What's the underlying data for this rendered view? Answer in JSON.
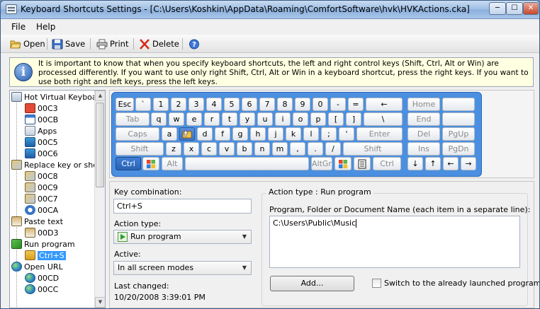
{
  "window": {
    "title": "Keyboard Shortcuts Settings - [C:\\Users\\Koshkin\\AppData\\Roaming\\ComfortSoftware\\hvk\\HVKActions.cka]",
    "min_glyph": "─",
    "max_glyph": "☐",
    "close_glyph": "✕"
  },
  "menu": {
    "file": "File",
    "help": "Help"
  },
  "toolbar": {
    "open": "Open",
    "save": "Save",
    "print": "Print",
    "delete": "Delete"
  },
  "info": {
    "text": "It is important to know that when you specify keyboard shortcuts, the left and right control keys (Shift, Ctrl, Alt or Win) are processed differently. If you want to use only right Shift, Ctrl, Alt or Win in a keyboard shortcut, press the right keys. If you want to use both right and left keys, press the left keys."
  },
  "tree": {
    "nodes": [
      {
        "label": "Hot Virtual Keyboard",
        "level": 0,
        "icon": "keyboard-icon"
      },
      {
        "label": "00C3",
        "level": 1,
        "icon": "red-x-icon"
      },
      {
        "label": "00CB",
        "level": 1,
        "icon": "window-icon"
      },
      {
        "label": "Apps",
        "level": 1,
        "icon": "apps-icon"
      },
      {
        "label": "00C5",
        "level": 1,
        "icon": "monitor-icon"
      },
      {
        "label": "00C6",
        "level": 1,
        "icon": "monitor-icon"
      },
      {
        "label": "Replace key or shortcut",
        "level": 0,
        "icon": "replace-icon"
      },
      {
        "label": "00C8",
        "level": 1,
        "icon": "replace-icon"
      },
      {
        "label": "00C9",
        "level": 1,
        "icon": "replace-icon"
      },
      {
        "label": "00C7",
        "level": 1,
        "icon": "replace-icon"
      },
      {
        "label": "00CA",
        "level": 1,
        "icon": "undo-icon"
      },
      {
        "label": "Paste text",
        "level": 0,
        "icon": "paste-text-icon"
      },
      {
        "label": "00D3",
        "level": 1,
        "icon": "paste-text-icon"
      },
      {
        "label": "Run program",
        "level": 0,
        "icon": "run-icon"
      },
      {
        "label": "Ctrl+S",
        "level": 1,
        "icon": "folder-hand-icon",
        "selected": true
      },
      {
        "label": "Open URL",
        "level": 0,
        "icon": "globe-icon"
      },
      {
        "label": "00CD",
        "level": 1,
        "icon": "globe-icon"
      },
      {
        "label": "00CC",
        "level": 1,
        "icon": "globe-icon"
      }
    ]
  },
  "keyboard": {
    "rows": [
      [
        "Esc",
        "`",
        "1",
        "2",
        "3",
        "4",
        "5",
        "6",
        "7",
        "8",
        "9",
        "0",
        "-",
        "=",
        "←"
      ],
      [
        "Tab",
        "q",
        "w",
        "e",
        "r",
        "t",
        "y",
        "u",
        "i",
        "o",
        "p",
        "[",
        "]",
        "\\"
      ],
      [
        "Caps",
        "a",
        "",
        "d",
        "f",
        "g",
        "h",
        "j",
        "k",
        "l",
        ";",
        "'",
        "Enter"
      ],
      [
        "Shift",
        "z",
        "x",
        "c",
        "v",
        "b",
        "n",
        "m",
        ",",
        ".",
        "/",
        "Shift"
      ],
      [
        "Ctrl",
        "",
        "Alt",
        "",
        "AltGr",
        "",
        "",
        "Ctrl"
      ]
    ],
    "nav": [
      [
        "Home"
      ],
      [
        "End"
      ],
      [
        "Del",
        "PgUp"
      ],
      [
        "Ins",
        "PgDn"
      ],
      [
        "↓",
        "↑",
        "←",
        "→"
      ]
    ]
  },
  "form": {
    "key_combination_label": "Key combination:",
    "key_combination_value": "Ctrl+S",
    "action_type_label": "Action type:",
    "action_type_value": "Run program",
    "active_label": "Active:",
    "active_value": "In all screen modes",
    "last_changed_label": "Last changed:",
    "last_changed_value": "10/20/2008 3:39:01 PM",
    "group_title": "Action type : Run program",
    "program_label": "Program, Folder or Document Name (each item in a separate line):",
    "program_value": "C:\\Users\\Public\\Music",
    "add_button": "Add...",
    "switch_label": "Switch to the already launched program",
    "switch_checked": false
  }
}
